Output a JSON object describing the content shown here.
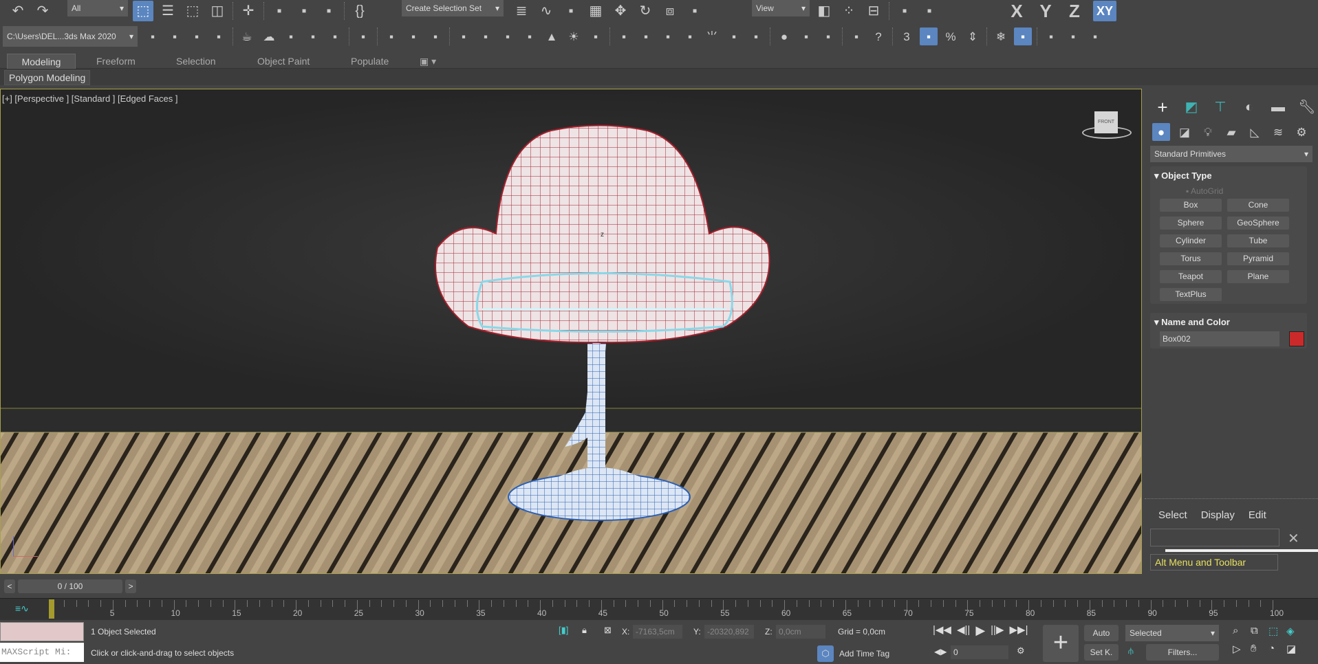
{
  "toolbar1": {
    "selection_filter": "All",
    "named_set": "Create Selection Set",
    "ref_coord": "View",
    "axes": [
      "X",
      "Y",
      "Z",
      "XY"
    ],
    "icons": [
      "undo-icon",
      "redo-icon",
      "|",
      "select-object-icon",
      "select-by-name-icon",
      "rect-selection-icon",
      "window-crossing-icon",
      "|",
      "select-move-icon",
      "|",
      "render-setup-icon",
      "render-production-icon",
      "render-cloud-icon",
      "|",
      "edit-named-sets-icon"
    ],
    "icons2": [
      "layer-explorer-icon",
      "curve-editor-icon",
      "schematic-icon",
      "material-editor-icon",
      "move-icon",
      "rotate-icon",
      "scale-icon",
      "pivot-icon"
    ],
    "icons3": [
      "mirror-icon",
      "array-icon",
      "align-icon",
      "|",
      "quick-align-icon",
      "place-highlight-icon"
    ]
  },
  "toolbar2": {
    "project_path": "C:\\Users\\DEL...3ds Max 2020",
    "icons": [
      "project-settings-icon",
      "project-folder-icon",
      "project-tree-icon",
      "project-paths-icon",
      "|",
      "teapot-icon",
      "cloud-icon",
      "render-frame-icon",
      "render-settings-icon",
      "render-panel-icon",
      "|",
      "light-list-icon",
      "|",
      "camera-icon",
      "camera-seq-icon",
      "render-cam-icon",
      "|",
      "material-box-icon",
      "material-blob-icon",
      "material-sphere-icon",
      "teapot-material-icon",
      "cone-icon",
      "sun-icon",
      "sphere-material-icon",
      "|",
      "particles-icon",
      "molecule-icon",
      "physique-icon",
      "geosphere-icon",
      "grass-icon",
      "hair-icon",
      "ox-hair-icon",
      "|",
      "sphere-icon",
      "maps-icon",
      "obj-color-icon",
      "|",
      "doc-icon",
      "help-icon",
      "|",
      "snap-3d-icon",
      "angle-snap-icon",
      "percent-snap-icon",
      "spinner-snap-icon",
      "|",
      "freeze-icon",
      "xy-constraint-icon",
      "|",
      "grid-snap-icon",
      "axis-constraint-icon",
      "extra-icon"
    ]
  },
  "ribbon": {
    "tabs": [
      "Modeling",
      "Freeform",
      "Selection",
      "Object Paint",
      "Populate"
    ],
    "active": "Modeling",
    "sub_label": "Polygon Modeling"
  },
  "viewport": {
    "label": "[+] [Perspective ] [Standard ] [Edged Faces ]",
    "viewcube": "FRONT",
    "gizmo_z": "z"
  },
  "command_panel": {
    "category": "Standard Primitives",
    "object_type_title": "Object Type",
    "autogrid": "AutoGrid",
    "buttons": [
      "Box",
      "Cone",
      "Sphere",
      "GeoSphere",
      "Cylinder",
      "Tube",
      "Torus",
      "Pyramid",
      "Teapot",
      "Plane",
      "TextPlus"
    ],
    "name_color_title": "Name and Color",
    "object_name": "Box002",
    "object_color": "#cc2a2a"
  },
  "scene_explorer": {
    "menus": [
      "Select",
      "Display",
      "Edit"
    ],
    "search_value": "",
    "workspace": "Alt Menu and Toolbar"
  },
  "timeline": {
    "frame_label": "0 / 100",
    "prev": "<",
    "next": ">",
    "ticks": [
      "0",
      "5",
      "10",
      "15",
      "20",
      "25",
      "30",
      "35",
      "40",
      "45",
      "50",
      "55",
      "60",
      "65",
      "70",
      "75",
      "80",
      "85",
      "90",
      "95",
      "100"
    ],
    "current_frame": 0,
    "total_frames": 100
  },
  "status": {
    "selected": "1 Object Selected",
    "prompt": "Click or click-and-drag to select objects",
    "maxscript": "MAXScript Mi:",
    "x_label": "X:",
    "x": "-7163,5cm",
    "y_label": "Y:",
    "y": "-20320,892",
    "z_label": "Z:",
    "z": "0,0cm",
    "grid": "Grid = 0,0cm",
    "add_time_tag": "Add Time Tag"
  },
  "anim": {
    "frame": "0",
    "auto": "Auto",
    "set_key": "Set K.",
    "key_filter": "Selected",
    "filters": "Filters..."
  }
}
